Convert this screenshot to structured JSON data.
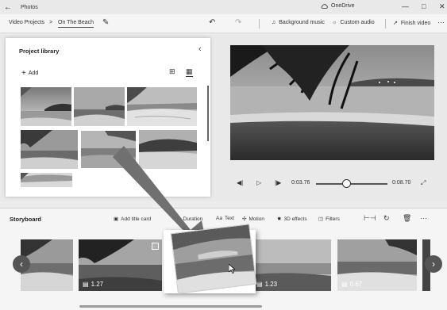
{
  "titlebar": {
    "back_icon": "back-arrow-icon",
    "app_name": "Photos",
    "onedrive": "OneDrive",
    "controls": [
      "—",
      "□",
      "✕"
    ]
  },
  "commandbar": {
    "breadcrumb_root": "Video Projects",
    "breadcrumb_sep": ">",
    "breadcrumb_current": "On The Beach",
    "background_music": "Background music",
    "custom_audio": "Custom audio",
    "finish_video": "Finish video",
    "more": "···"
  },
  "library": {
    "title": "Project library",
    "add_label": "Add"
  },
  "playback": {
    "current_time": "0:03.76",
    "total_time": "0:08.70",
    "position": 0.43
  },
  "storyboard": {
    "title": "Storyboard",
    "add_title_card": "Add title card",
    "duration": "Duration",
    "text": "Text",
    "motion": "Motion",
    "effects_3d": "3D effects",
    "filters": "Filters",
    "more": "···",
    "clips": [
      {
        "duration": ""
      },
      {
        "duration": "1.27"
      },
      {
        "duration": "1.23"
      },
      {
        "duration": "0.67"
      }
    ]
  },
  "colors": {
    "titlebar_bg": "#e9e9e9",
    "panel_bg": "#ffffff",
    "storyboard_bg": "#f5f5f5",
    "drag_arrow": "#707070"
  }
}
